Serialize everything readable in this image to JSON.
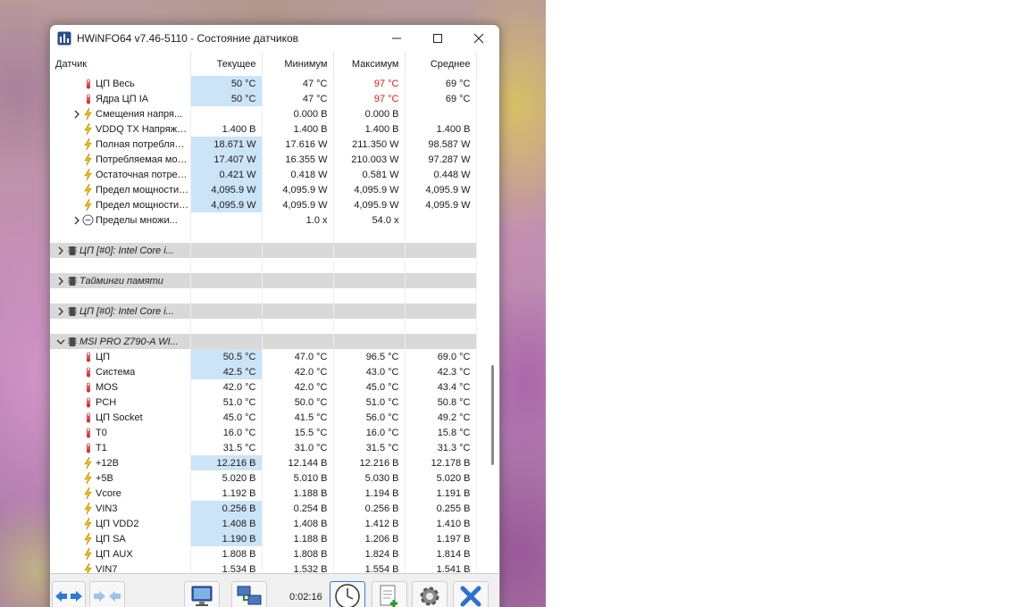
{
  "window": {
    "title": "HWiNFO64 v7.46-5110 - Состояние датчиков"
  },
  "columns": [
    "Датчик",
    "Текущее",
    "Минимум",
    "Максимум",
    "Среднее"
  ],
  "rows": [
    {
      "type": "sensor",
      "indent": 1,
      "icon": "thermometer-icon",
      "label": "ЦП Весь",
      "values": [
        "50 °C",
        "47 °C",
        "97 °C",
        "69 °C"
      ],
      "highlight": true,
      "max_red": true
    },
    {
      "type": "sensor",
      "indent": 1,
      "icon": "thermometer-icon",
      "label": "Ядра ЦП IA",
      "values": [
        "50 °C",
        "47 °C",
        "97 °C",
        "69 °C"
      ],
      "highlight": true,
      "max_red": true
    },
    {
      "type": "sensor",
      "indent": 1,
      "expander": true,
      "icon": "lightning-icon",
      "label": "Смещения напря...",
      "values": [
        "",
        "0.000 В",
        "0.000 В",
        ""
      ]
    },
    {
      "type": "sensor",
      "indent": 1,
      "icon": "lightning-icon",
      "label": "VDDQ TX Напряжение",
      "values": [
        "1.400 В",
        "1.400 В",
        "1.400 В",
        "1.400 В"
      ]
    },
    {
      "type": "sensor",
      "indent": 1,
      "icon": "lightning-icon",
      "label": "Полная потребляем...",
      "values": [
        "18.671 W",
        "17.616 W",
        "211.350 W",
        "98.587 W"
      ],
      "highlight": true
    },
    {
      "type": "sensor",
      "indent": 1,
      "icon": "lightning-icon",
      "label": "Потребляемая мощ...",
      "values": [
        "17.407 W",
        "16.355 W",
        "210.003 W",
        "97.287 W"
      ],
      "highlight": true
    },
    {
      "type": "sensor",
      "indent": 1,
      "icon": "lightning-icon",
      "label": "Остаточная потреб...",
      "values": [
        "0.421 W",
        "0.418 W",
        "0.581 W",
        "0.448 W"
      ],
      "highlight": true
    },
    {
      "type": "sensor",
      "indent": 1,
      "icon": "lightning-icon",
      "label": "Предел мощности P...",
      "values": [
        "4,095.9 W",
        "4,095.9 W",
        "4,095.9 W",
        "4,095.9 W"
      ],
      "highlight": true
    },
    {
      "type": "sensor",
      "indent": 1,
      "icon": "lightning-icon",
      "label": "Предел мощности P...",
      "values": [
        "4,095.9 W",
        "4,095.9 W",
        "4,095.9 W",
        "4,095.9 W"
      ],
      "highlight": true
    },
    {
      "type": "sensor",
      "indent": 1,
      "expander": true,
      "icon": "clock-icon",
      "label": "Пределы множи...",
      "values": [
        "",
        "1.0 x",
        "54.0 x",
        ""
      ]
    },
    {
      "type": "spacer"
    },
    {
      "type": "group",
      "expander": true,
      "collapsed": true,
      "icon": "chip-icon",
      "label": "ЦП [#0]: Intel Core i..."
    },
    {
      "type": "spacer"
    },
    {
      "type": "group",
      "expander": true,
      "collapsed": true,
      "icon": "chip-icon",
      "label": "Тайминги памяти"
    },
    {
      "type": "spacer"
    },
    {
      "type": "group",
      "expander": true,
      "collapsed": true,
      "icon": "chip-icon",
      "label": "ЦП [#0]: Intel Core i..."
    },
    {
      "type": "spacer"
    },
    {
      "type": "group",
      "expander": true,
      "collapsed": false,
      "icon": "chip-icon",
      "label": "MSI PRO Z790-A WI..."
    },
    {
      "type": "sensor",
      "indent": 1,
      "icon": "thermometer-icon",
      "label": "ЦП",
      "values": [
        "50.5 °C",
        "47.0 °C",
        "96.5 °C",
        "69.0 °C"
      ],
      "highlight": true
    },
    {
      "type": "sensor",
      "indent": 1,
      "icon": "thermometer-icon",
      "label": "Система",
      "values": [
        "42.5 °C",
        "42.0 °C",
        "43.0 °C",
        "42.3 °C"
      ],
      "highlight": true
    },
    {
      "type": "sensor",
      "indent": 1,
      "icon": "thermometer-icon",
      "label": "MOS",
      "values": [
        "42.0 °C",
        "42.0 °C",
        "45.0 °C",
        "43.4 °C"
      ]
    },
    {
      "type": "sensor",
      "indent": 1,
      "icon": "thermometer-icon",
      "label": "PCH",
      "values": [
        "51.0 °C",
        "50.0 °C",
        "51.0 °C",
        "50.8 °C"
      ]
    },
    {
      "type": "sensor",
      "indent": 1,
      "icon": "thermometer-icon",
      "label": "ЦП Socket",
      "values": [
        "45.0 °C",
        "41.5 °C",
        "56.0 °C",
        "49.2 °C"
      ]
    },
    {
      "type": "sensor",
      "indent": 1,
      "icon": "thermometer-icon",
      "label": "T0",
      "values": [
        "16.0 °C",
        "15.5 °C",
        "16.0 °C",
        "15.8 °C"
      ]
    },
    {
      "type": "sensor",
      "indent": 1,
      "icon": "thermometer-icon",
      "label": "T1",
      "values": [
        "31.5 °C",
        "31.0 °C",
        "31.5 °C",
        "31.3 °C"
      ]
    },
    {
      "type": "sensor",
      "indent": 1,
      "icon": "lightning-icon",
      "label": "+12В",
      "values": [
        "12.216 В",
        "12.144 В",
        "12.216 В",
        "12.178 В"
      ],
      "highlight": true
    },
    {
      "type": "sensor",
      "indent": 1,
      "icon": "lightning-icon",
      "label": "+5В",
      "values": [
        "5.020 В",
        "5.010 В",
        "5.030 В",
        "5.020 В"
      ]
    },
    {
      "type": "sensor",
      "indent": 1,
      "icon": "lightning-icon",
      "label": "Vcore",
      "values": [
        "1.192 В",
        "1.188 В",
        "1.194 В",
        "1.191 В"
      ]
    },
    {
      "type": "sensor",
      "indent": 1,
      "icon": "lightning-icon",
      "label": "VIN3",
      "values": [
        "0.256 В",
        "0.254 В",
        "0.256 В",
        "0.255 В"
      ],
      "highlight": true
    },
    {
      "type": "sensor",
      "indent": 1,
      "icon": "lightning-icon",
      "label": "ЦП VDD2",
      "values": [
        "1.408 В",
        "1.408 В",
        "1.412 В",
        "1.410 В"
      ],
      "highlight": true
    },
    {
      "type": "sensor",
      "indent": 1,
      "icon": "lightning-icon",
      "label": "ЦП SA",
      "values": [
        "1.190 В",
        "1.188 В",
        "1.206 В",
        "1.197 В"
      ],
      "highlight": true
    },
    {
      "type": "sensor",
      "indent": 1,
      "icon": "lightning-icon",
      "label": "ЦП AUX",
      "values": [
        "1.808 В",
        "1.808 В",
        "1.824 В",
        "1.814 В"
      ]
    },
    {
      "type": "sensor",
      "indent": 1,
      "icon": "lightning-icon",
      "label": "VIN7",
      "values": [
        "1.534 В",
        "1.532 В",
        "1.554 В",
        "1.541 В"
      ]
    }
  ],
  "toolbar": {
    "timer": "0:02:16",
    "buttons": [
      "nav-arrows-icon",
      "nav-arrows-disabled-icon",
      "monitor-icon",
      "network-icon",
      "clock-icon",
      "report-icon",
      "gear-icon",
      "close-icon"
    ]
  },
  "colors": {
    "highlight": "#cce4f7",
    "max_alert": "#d41a1a",
    "group_bg": "#d9d9d9"
  }
}
